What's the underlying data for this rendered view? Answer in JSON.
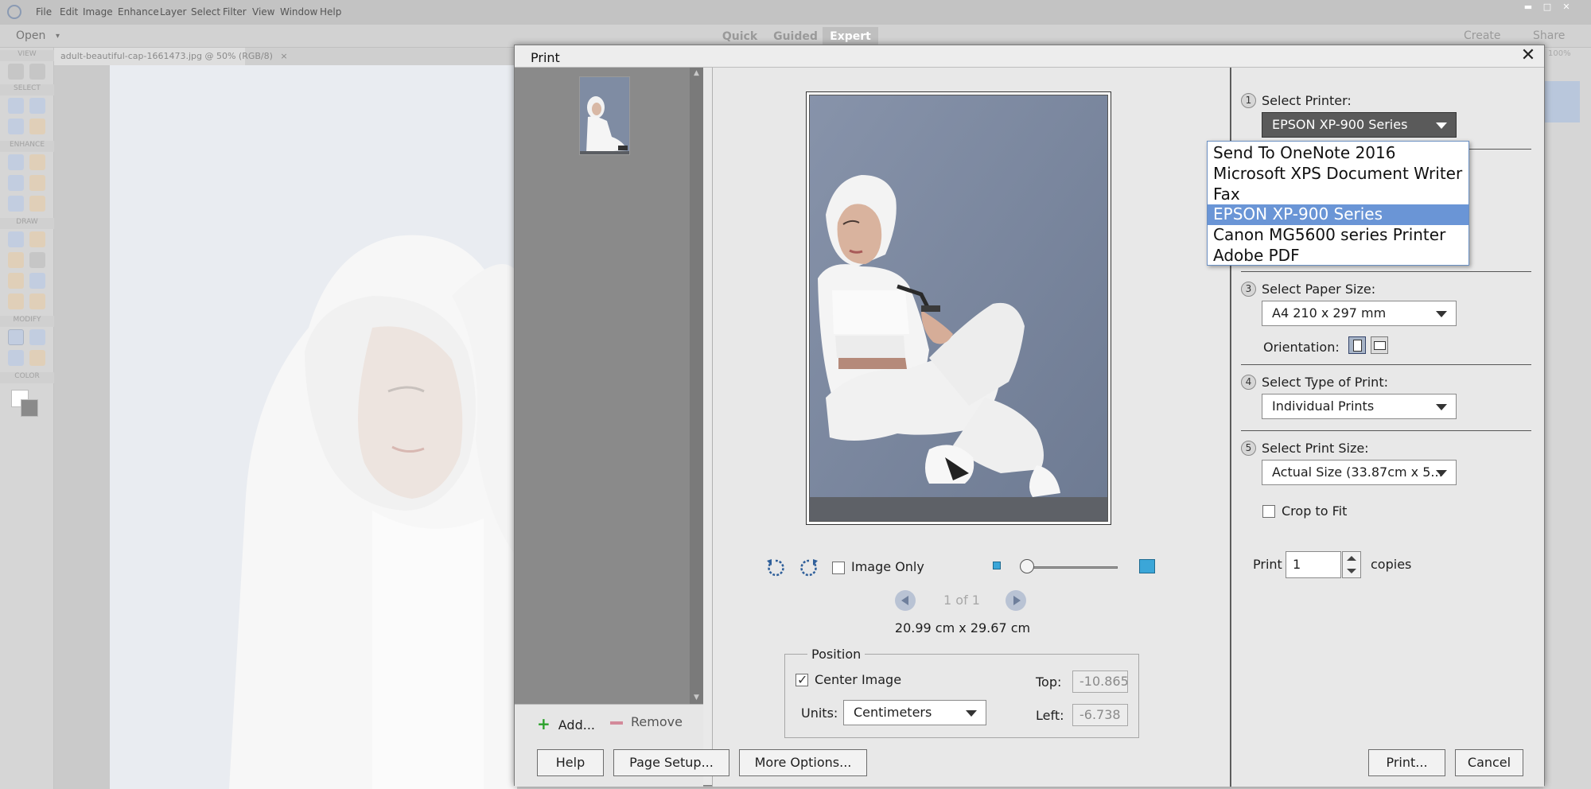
{
  "menubar": {
    "items": [
      "File",
      "Edit",
      "Image",
      "Enhance",
      "Layer",
      "Select",
      "Filter",
      "View",
      "Window",
      "Help"
    ]
  },
  "modebar": {
    "open_label": "Open",
    "tabs": [
      "Quick",
      "Guided",
      "Expert"
    ],
    "active_tab": "Expert",
    "create_label": "Create",
    "share_label": "Share"
  },
  "toolbox": {
    "sections": [
      "VIEW",
      "SELECT",
      "ENHANCE",
      "DRAW",
      "MODIFY",
      "COLOR"
    ]
  },
  "document_tab": {
    "title": "adult-beautiful-cap-1661473.jpg @ 50% (RGB/8)",
    "close": "×"
  },
  "right_panel": {
    "zoom_fragment": "100%"
  },
  "dialog": {
    "title": "Print",
    "close_glyph": "✕",
    "thumbnails": {
      "add_label": "Add...",
      "remove_label": "Remove"
    },
    "preview": {
      "image_only_label": "Image Only",
      "page_indicator": "1 of 1",
      "size_label": "20.99 cm x 29.67 cm",
      "position": {
        "legend": "Position",
        "center_image_label": "Center Image",
        "center_image_checked": true,
        "units_label": "Units:",
        "units_value": "Centimeters",
        "top_label": "Top:",
        "top_value": "-10.865",
        "left_label": "Left:",
        "left_value": "-6.738"
      }
    },
    "settings": {
      "step1": {
        "num": "1",
        "label": "Select Printer:",
        "value": "EPSON XP-900 Series"
      },
      "step3": {
        "num": "3",
        "label": "Select Paper Size:",
        "value": "A4 210 x 297 mm"
      },
      "orientation_label": "Orientation:",
      "step4": {
        "num": "4",
        "label": "Select Type of Print:",
        "value": "Individual Prints"
      },
      "step5": {
        "num": "5",
        "label": "Select Print Size:",
        "value": "Actual Size (33.87cm x 5..."
      },
      "crop_to_fit_label": "Crop to Fit",
      "print_label": "Print",
      "copies_value": "1",
      "copies_label": "copies"
    },
    "printer_dropdown": {
      "options": [
        "Send To OneNote 2016",
        "Microsoft XPS Document Writer",
        "Fax",
        "EPSON XP-900 Series",
        "Canon MG5600 series Printer",
        "Adobe PDF"
      ],
      "selected": "EPSON XP-900 Series"
    },
    "footer": {
      "help": "Help",
      "page_setup": "Page Setup...",
      "more_options": "More Options...",
      "print": "Print...",
      "cancel": "Cancel"
    }
  },
  "colors": {
    "accent": "#6a95d6",
    "zoom_blue": "#3ba6d8",
    "add_green": "#2aa12a",
    "remove_pink": "#d38a9a"
  }
}
